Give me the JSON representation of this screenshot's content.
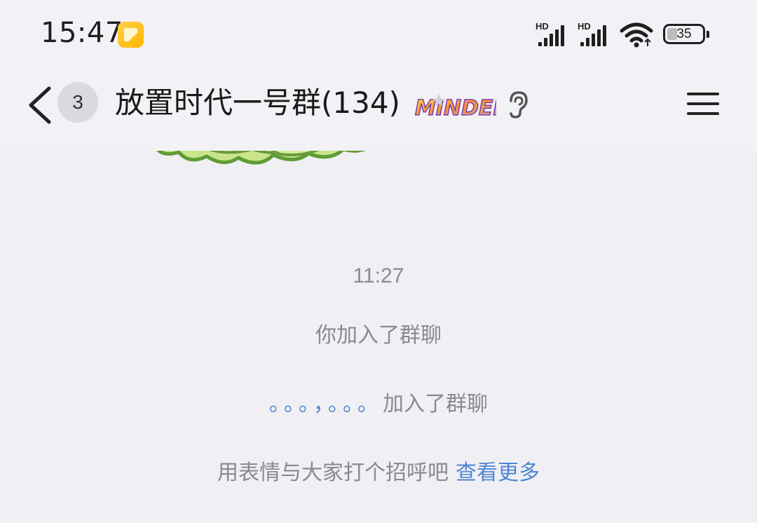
{
  "status_bar": {
    "time": "15:47",
    "signal_1_label": "HD",
    "signal_2_label": "HD",
    "battery_level": "35",
    "icons": [
      "notification-app-icon",
      "signal-icon",
      "signal-icon",
      "wifi-icon",
      "battery-icon"
    ]
  },
  "header": {
    "unread_count": "3",
    "group_title": "放置时代一号群(134)",
    "badge_text": "MINDED",
    "icons": [
      "back-chevron-icon",
      "minded-badge-icon",
      "ear-icon",
      "menu-icon"
    ]
  },
  "chat": {
    "timestamp": "11:27",
    "system_messages": {
      "self_joined": "你加入了群聊",
      "member_name": "。。。，。。。",
      "member_joined_suffix": "加入了群聊",
      "greeting_prompt": "用表情与大家打个招呼吧",
      "see_more_link": "查看更多"
    }
  },
  "colors": {
    "background": "#efeff4",
    "header_background": "#f2f2f6",
    "system_text": "#8a8a8e",
    "link_blue": "#4e86d2",
    "sticker_green": "#c9e58a"
  }
}
